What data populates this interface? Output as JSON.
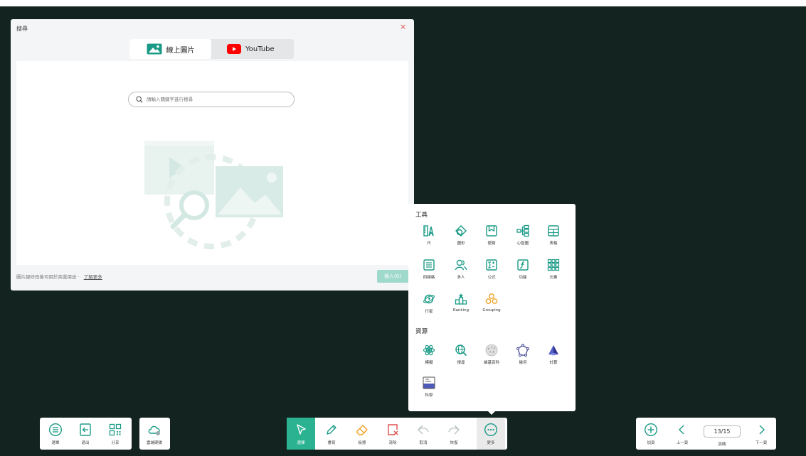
{
  "search_dialog": {
    "title": "搜尋",
    "close_glyph": "×",
    "tabs": [
      {
        "label": "線上圖片",
        "icon": "image-icon"
      },
      {
        "label": "YouTube",
        "icon": "youtube-icon"
      }
    ],
    "search_placeholder": "請輸入關鍵字進行搜尋",
    "footer_text": "圖片經修改後可用於商業用途 · ",
    "learn_more": "了解更多",
    "insert_label": "插入(0)"
  },
  "tools_panel": {
    "tools_title": "工具",
    "tools": [
      {
        "label": "尺",
        "icon": "ruler-icon"
      },
      {
        "label": "圖形",
        "icon": "shapes-icon"
      },
      {
        "label": "便簽",
        "icon": "sticky-note-icon"
      },
      {
        "label": "心智圖",
        "icon": "mind-map-icon"
      },
      {
        "label": "表格",
        "icon": "table-icon"
      },
      {
        "label": "四線格",
        "icon": "four-line-grid-icon"
      },
      {
        "label": "多人",
        "icon": "multi-user-icon"
      },
      {
        "label": "公式",
        "icon": "formula-icon"
      },
      {
        "label": "功能",
        "icon": "function-icon"
      },
      {
        "label": "元素",
        "icon": "elements-icon"
      },
      {
        "label": "行星",
        "icon": "planet-icon"
      },
      {
        "label": "Ranking",
        "icon": "ranking-icon"
      },
      {
        "label": "Grouping",
        "icon": "grouping-icon"
      }
    ],
    "resources_title": "資源",
    "resources": [
      {
        "label": "模擬",
        "icon": "simulation-icon"
      },
      {
        "label": "搜尋",
        "icon": "search-globe-icon"
      },
      {
        "label": "維基百科",
        "icon": "wikipedia-icon"
      },
      {
        "label": "幾何",
        "icon": "geometry-icon"
      },
      {
        "label": "計算",
        "icon": "calculator-pyramid-icon"
      },
      {
        "label": "科學",
        "icon": "science-icon"
      }
    ]
  },
  "left_toolbar": [
    {
      "label": "選單",
      "icon": "menu-icon"
    },
    {
      "label": "退出",
      "icon": "exit-icon"
    },
    {
      "label": "分享",
      "icon": "qr-share-icon"
    }
  ],
  "cloud_button": {
    "label": "雲端硬碟",
    "icon": "cloud-drive-icon"
  },
  "center_toolbar": [
    {
      "label": "選擇",
      "icon": "select-cursor-icon"
    },
    {
      "label": "書寫",
      "icon": "pen-icon"
    },
    {
      "label": "板擦",
      "icon": "eraser-icon"
    },
    {
      "label": "清除",
      "icon": "clear-icon"
    },
    {
      "label": "取消",
      "icon": "undo-icon"
    },
    {
      "label": "恢復",
      "icon": "redo-icon"
    },
    {
      "label": "更多",
      "icon": "more-icon"
    }
  ],
  "right_toolbar": {
    "add_page": "加頁",
    "prev_page": "上一頁",
    "page_indicator": "13/15",
    "page_label": "頁碼",
    "next_page": "下一頁"
  },
  "colors": {
    "board": "#13231f",
    "accent": "#2bb391",
    "icon_teal": "#1a9a86",
    "close": "#e05050",
    "youtube_red": "#ff0000"
  }
}
